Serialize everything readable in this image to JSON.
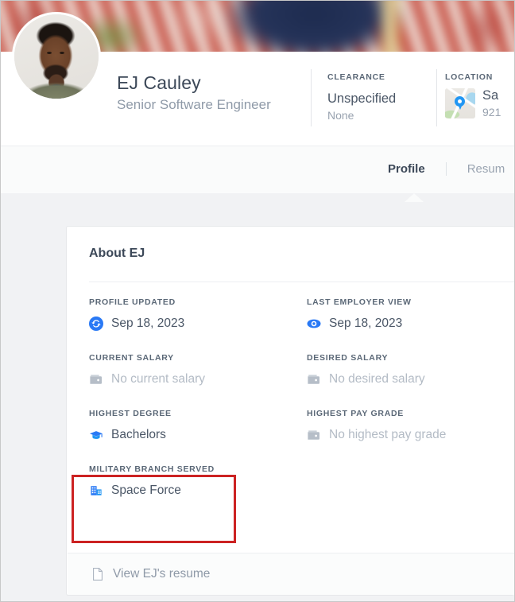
{
  "colors": {
    "accent_blue": "#2196f3",
    "muted_gray": "#b3bbc5",
    "text_dark": "#3c4858",
    "highlight_red": "#cc2222",
    "page_bg": "#f1f2f4"
  },
  "banner": {
    "image_name": "american-flags-banner"
  },
  "profile": {
    "avatar_name": "profile-avatar-photo",
    "name": "EJ Cauley",
    "title": "Senior Software Engineer",
    "facets": [
      {
        "key": "clearance",
        "label": "CLEARANCE",
        "value": "Unspecified",
        "subvalue": "None"
      },
      {
        "key": "location",
        "label": "LOCATION",
        "icon": "map-pin-icon",
        "value": "Sa",
        "subvalue": "921"
      }
    ]
  },
  "tabs": [
    {
      "label": "Profile",
      "active": true
    },
    {
      "label": "Resum",
      "active": false
    }
  ],
  "card": {
    "title": "About EJ",
    "fields": [
      {
        "label": "PROFILE UPDATED",
        "value": "Sep 18, 2023",
        "icon": "refresh-circle-icon",
        "muted": false
      },
      {
        "label": "LAST EMPLOYER VIEW",
        "value": "Sep 18, 2023",
        "icon": "eye-icon",
        "muted": false
      },
      {
        "label": "CURRENT SALARY",
        "value": "No current salary",
        "icon": "wallet-icon",
        "muted": true
      },
      {
        "label": "DESIRED SALARY",
        "value": "No desired salary",
        "icon": "wallet-icon",
        "muted": true
      },
      {
        "label": "HIGHEST DEGREE",
        "value": "Bachelors",
        "icon": "graduation-cap-icon",
        "muted": false
      },
      {
        "label": "HIGHEST PAY GRADE",
        "value": "No highest pay grade",
        "icon": "wallet-icon",
        "muted": true
      },
      {
        "label": "MILITARY BRANCH SERVED",
        "value": "Space Force",
        "icon": "building-icon",
        "muted": false
      }
    ],
    "footer": {
      "resume_link_label": "View EJ's resume",
      "resume_link_icon": "document-icon"
    }
  },
  "annotation": {
    "highlight_target": "MILITARY BRANCH SERVED"
  }
}
